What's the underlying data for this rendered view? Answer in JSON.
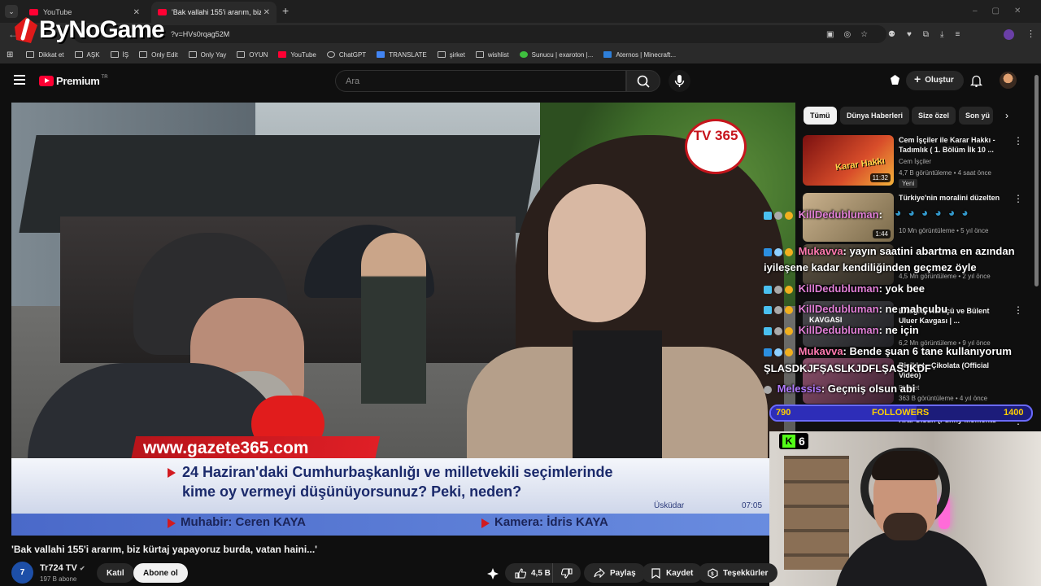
{
  "browser": {
    "tabs": [
      {
        "title": "YouTube"
      },
      {
        "title": "'Bak vallahi 155'i ararım, biz kür"
      }
    ],
    "new_tab": "+",
    "url": "?v=HVs0rqag52M",
    "watermark": "ByNoGame",
    "bookmarks": [
      "Dikkat et",
      "AŞK",
      "İŞ",
      "Only Edit",
      "Only Yay",
      "OYUN",
      "YouTube",
      "ChatGPT",
      "TRANSLATE",
      "şirket",
      "wishlist",
      "Sunucu | exaroton |...",
      "Aternos | Minecraft..."
    ]
  },
  "header": {
    "logo": "Premium",
    "logo_sup": "TR",
    "search_placeholder": "Ara",
    "create_label": "Oluştur"
  },
  "video": {
    "channel_logo": "TV 365",
    "url_banner": "www.gazete365.com",
    "caption_line1": "24 Haziran'daki Cumhurbaşkanlığı ve milletvekili seçimlerinde",
    "caption_line2": "kime oy vermeyi düşünüyorsunuz? Peki, neden?",
    "reporter": "Muhabir: Ceren KAYA",
    "camera": "Kamera: İdris KAYA",
    "location": "Üsküdar",
    "time": "07:05",
    "title": "'Bak vallahi 155'i ararım, biz kürtaj yapayoruz burda, vatan haini...'",
    "channel": "Tr724 TV",
    "subs": "197 B abone",
    "join": "Katıl",
    "subscribe": "Abone ol",
    "likes": "4,5 B",
    "share": "Paylaş",
    "save": "Kaydet",
    "thanks": "Teşekkürler"
  },
  "chips": [
    "Tümü",
    "Dünya Haberleri",
    "Size özel",
    "Son yü"
  ],
  "recommendations": [
    {
      "title": "Cem İşçiler ile Karar Hakkı - Tadımlık ( 1. Bölüm İlk 10 ...",
      "channel": "Cem İşçiler",
      "meta": "4,7 B görüntüleme • 4 saat önce",
      "badge": "Yeni",
      "duration": "11:32",
      "thumb_text": "Karar Hakkı"
    },
    {
      "title": "Türkiye'nin moralini düzelten",
      "channel": "",
      "meta": "10 Mn görüntüleme • 5 yıl önce",
      "badge": "",
      "duration": "1:44",
      "thumb_text": ""
    },
    {
      "title": "",
      "channel": "",
      "meta": "4,5 Mn görüntüleme • 2 yıl önce",
      "badge": "",
      "duration": "",
      "thumb_text": ""
    },
    {
      "title": "Ertuğrul Kürkçü ve Bülent Uluer Kavgası | ...",
      "channel": "",
      "meta": "6,2 Mn görüntüleme • 9 yıl önce",
      "badge": "",
      "duration": "",
      "thumb_text": "KAVGASI"
    },
    {
      "title": "Bisiklet - Çikolata (Official Video)",
      "channel": "Bisiklet",
      "meta": "363 B görüntüleme • 4 yıl önce",
      "badge": "",
      "duration": "",
      "thumb_text": ""
    },
    {
      "title": "Kral Olsun (Funny Moments",
      "channel": "",
      "meta": "",
      "badge": "",
      "duration": "",
      "thumb_text": ""
    }
  ],
  "chat": [
    {
      "user": "KillDedubluman",
      "msg": ": ",
      "color": "#e17fd6"
    },
    {
      "user": "Mukavva",
      "msg": ": yayın saatini abartma en azından",
      "color": "#ff7ab0"
    },
    {
      "user": "",
      "msg": "iyileşene kadar kendiliğinden geçmez öyle",
      "color": "#fff"
    },
    {
      "user": "KillDedubluman",
      "msg": ": yok bee",
      "color": "#e17fd6"
    },
    {
      "user": "KillDedubluman",
      "msg": ": ne mahçubu",
      "color": "#e17fd6"
    },
    {
      "user": "KillDedubluman",
      "msg": ": ne için",
      "color": "#e17fd6"
    },
    {
      "user": "Mukavva",
      "msg": ": Bende şuan 6 tane kullanıyorum",
      "color": "#ff7ab0"
    },
    {
      "user": "",
      "msg": "ŞLASDKJFŞASLKJDFLŞASJKDF",
      "color": "#fff"
    },
    {
      "user": "Melessis",
      "msg": ": Geçmiş olsun abi",
      "color": "#b07aff"
    }
  ],
  "followers": {
    "current": "790",
    "label": "FOLLOWERS",
    "goal": "1400",
    "progress": 0.56
  },
  "kick": {
    "viewers": "6"
  },
  "colors": {
    "accent": "#ff0033",
    "bg": "#0f0f0f"
  }
}
